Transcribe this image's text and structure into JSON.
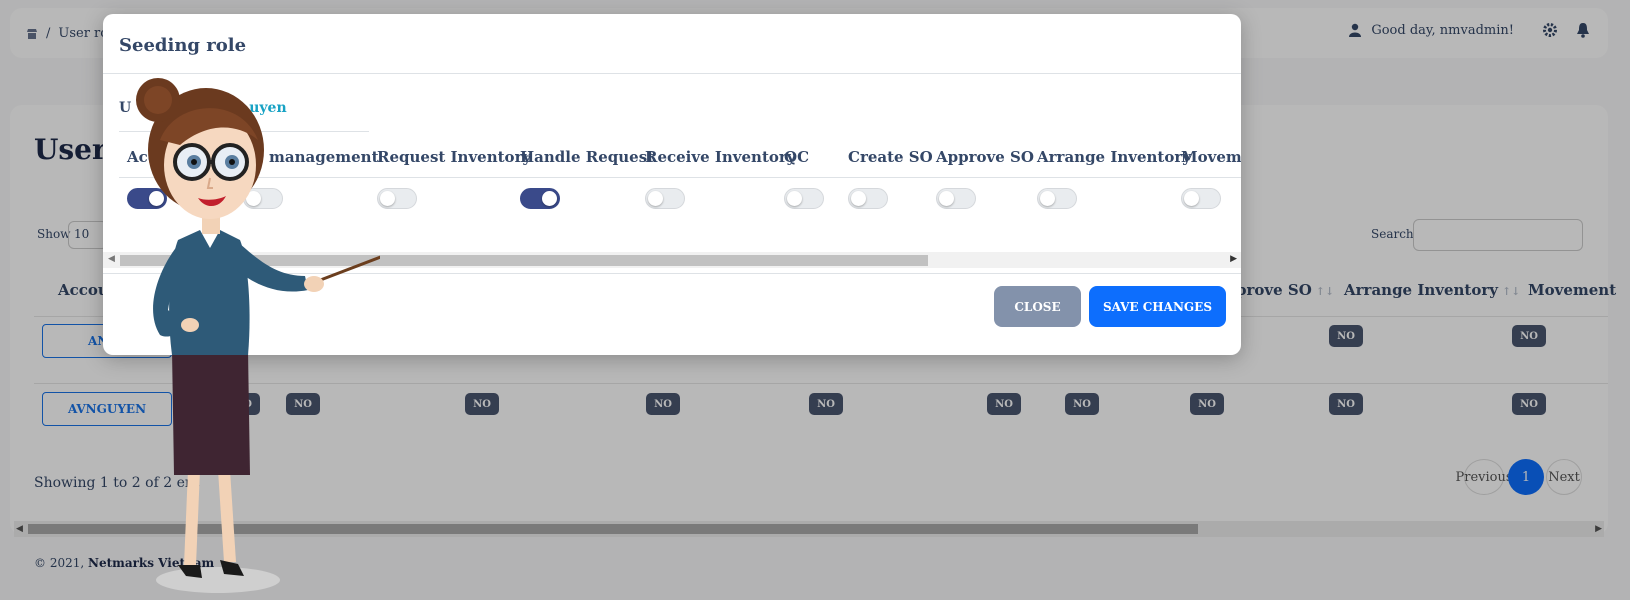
{
  "breadcrumb": {
    "current": "User rol"
  },
  "header": {
    "greeting": "Good day, nmvadmin!"
  },
  "page": {
    "title": "User r",
    "show_label": "Show",
    "show_value": "10",
    "search_label": "Search:",
    "table_headers": [
      "Accou",
      "prove SO",
      "Arrange Inventory",
      "Movement"
    ],
    "rows": [
      {
        "account": "ANVA",
        "badges": [
          "NO",
          "NO"
        ]
      },
      {
        "account": "AVNGUYEN",
        "badges": [
          "NO",
          "NO",
          "NO",
          "NO",
          "NO",
          "NO",
          "NO",
          "NO",
          "NO",
          "NO",
          "NO"
        ]
      }
    ],
    "showing": "Showing 1 to 2 of 2 ent",
    "pagination": {
      "prev": "Previous",
      "current": "1",
      "next": "Next"
    },
    "footer": {
      "prefix": "© 2021, ",
      "company": "Netmarks Vietnam"
    }
  },
  "modal": {
    "title": "Seeding role",
    "tab_prefix": "U",
    "tab_user": "uyen",
    "columns": [
      "Acc",
      "management",
      "Request Inventory",
      "Handle Request",
      "Receive Inventory",
      "QC",
      "Create SO",
      "Approve SO",
      "Arrange Inventory",
      "Moveme"
    ],
    "toggles": [
      true,
      false,
      false,
      true,
      false,
      false,
      false,
      false,
      false,
      false
    ],
    "close_label": "CLOSE",
    "save_label": "SAVE CHANGES"
  },
  "colors": {
    "primary": "#0d6efd",
    "toggle_on": "#3a4a8a",
    "close_btn": "#8392ab",
    "badge": "#4a5670",
    "tab_user": "#17a2c4"
  }
}
